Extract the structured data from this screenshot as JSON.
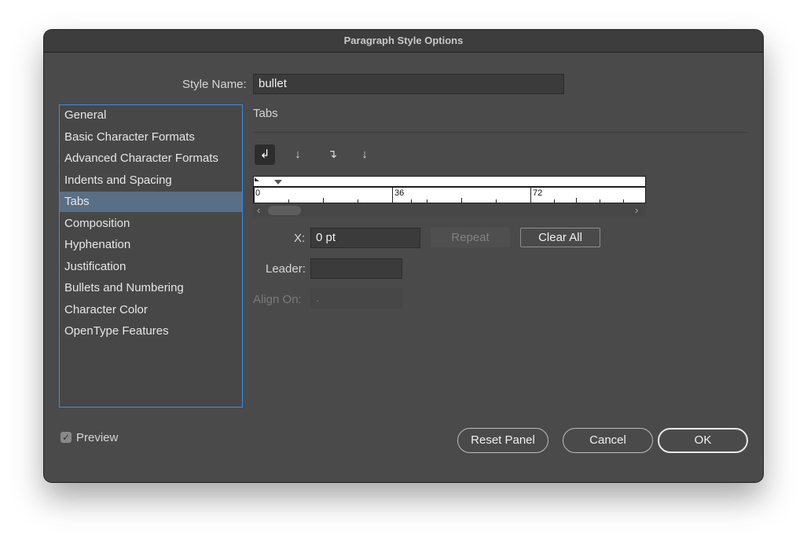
{
  "window": {
    "title": "Paragraph Style Options"
  },
  "style_name": {
    "label": "Style Name:",
    "value": "bullet"
  },
  "sidebar": {
    "items": [
      {
        "label": "General"
      },
      {
        "label": "Basic Character Formats"
      },
      {
        "label": "Advanced Character Formats"
      },
      {
        "label": "Indents and Spacing"
      },
      {
        "label": "Tabs",
        "selected": true
      },
      {
        "label": "Composition"
      },
      {
        "label": "Hyphenation"
      },
      {
        "label": "Justification"
      },
      {
        "label": "Bullets and Numbering"
      },
      {
        "label": "Character Color"
      },
      {
        "label": "OpenType Features"
      }
    ]
  },
  "tabs_panel": {
    "title": "Tabs",
    "tab_types": [
      {
        "icon": "left-justified-tab-icon",
        "glyph": "↲",
        "active": true
      },
      {
        "icon": "center-justified-tab-icon",
        "glyph": "↓"
      },
      {
        "icon": "right-justified-tab-icon",
        "glyph": "↴"
      },
      {
        "icon": "align-to-decimal-tab-icon",
        "glyph": "↓"
      }
    ],
    "ruler": {
      "labels": [
        "0",
        "36",
        "72"
      ]
    },
    "x_label": "X:",
    "x_value": "0 pt",
    "repeat_label": "Repeat",
    "clear_all_label": "Clear All",
    "leader_label": "Leader:",
    "leader_value": "",
    "align_on_label": "Align On:",
    "align_on_value": "."
  },
  "footer": {
    "preview_label": "Preview",
    "preview_checked": true,
    "reset_label": "Reset Panel",
    "cancel_label": "Cancel",
    "ok_label": "OK"
  },
  "colors": {
    "dialog_bg": "#4a4a4a",
    "selection": "#5a6f86",
    "focus_border": "#3a8ee6"
  }
}
